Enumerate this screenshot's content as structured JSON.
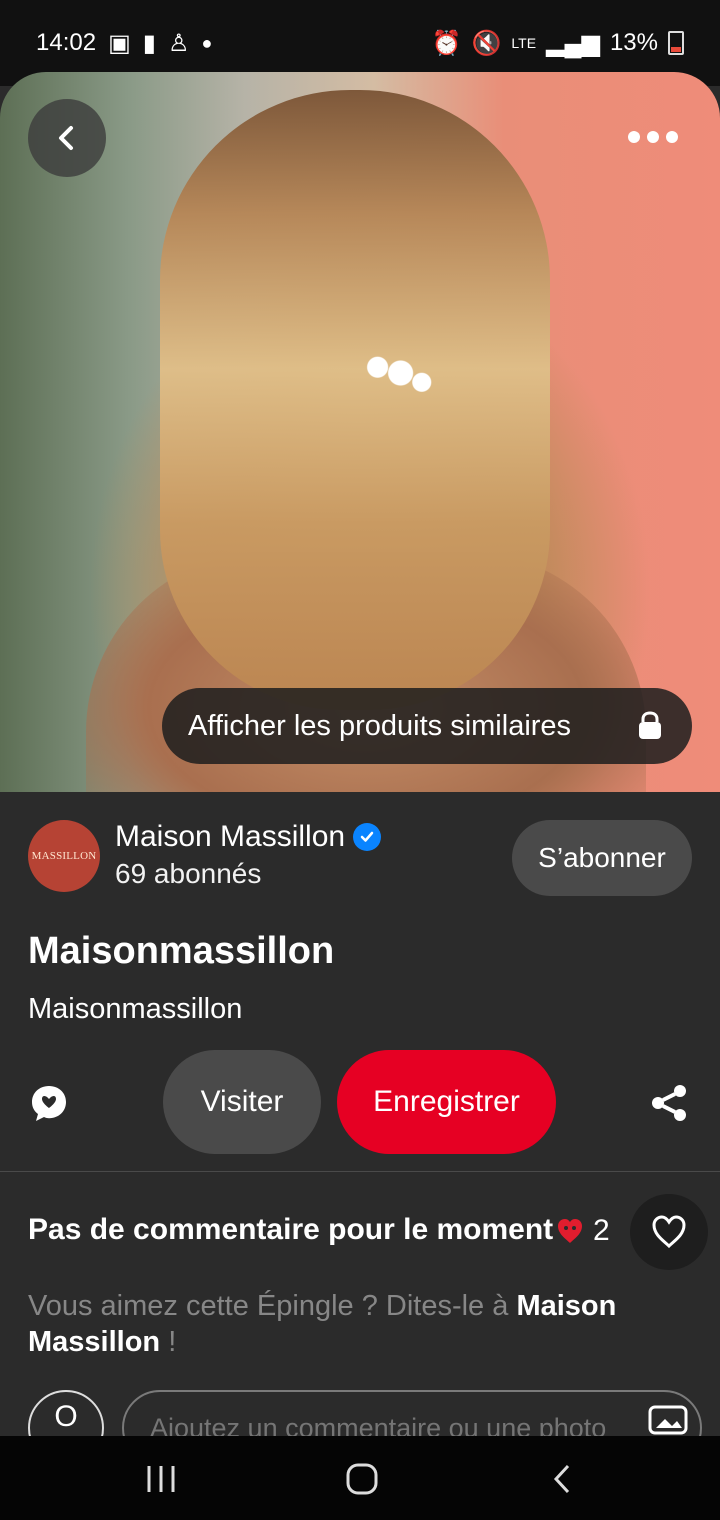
{
  "status_bar": {
    "time": "14:02",
    "battery_text": "13%",
    "network": "LTE"
  },
  "hero": {
    "shopping_button_label": "Afficher les produits similaires",
    "icons": [
      "chevron-left-icon",
      "more-horizontal-icon",
      "shopping-bag-icon"
    ]
  },
  "profile": {
    "name": "Maison Massillon",
    "followers": "69 abonnés",
    "avatar_text": "MASSILLON",
    "subscribe_label": "S’abonner"
  },
  "pin": {
    "title": "Maisonmassillon",
    "description": "Maisonmassillon"
  },
  "actions": {
    "visit_label": "Visiter",
    "save_label": "Enregistrer"
  },
  "comments": {
    "empty_text": "Pas de commentaire pour le moment",
    "reaction_count": "2",
    "invite_prefix": "Vous aimez cette Épingle ? Dites-le à ",
    "invite_name": "Maison Massillon",
    "invite_suffix": " !",
    "input_placeholder": "Ajoutez un commentaire ou une photo"
  },
  "colors": {
    "accent_red": "#e60023",
    "verified_blue": "#0a84ff",
    "background": "#2b2b2b"
  }
}
